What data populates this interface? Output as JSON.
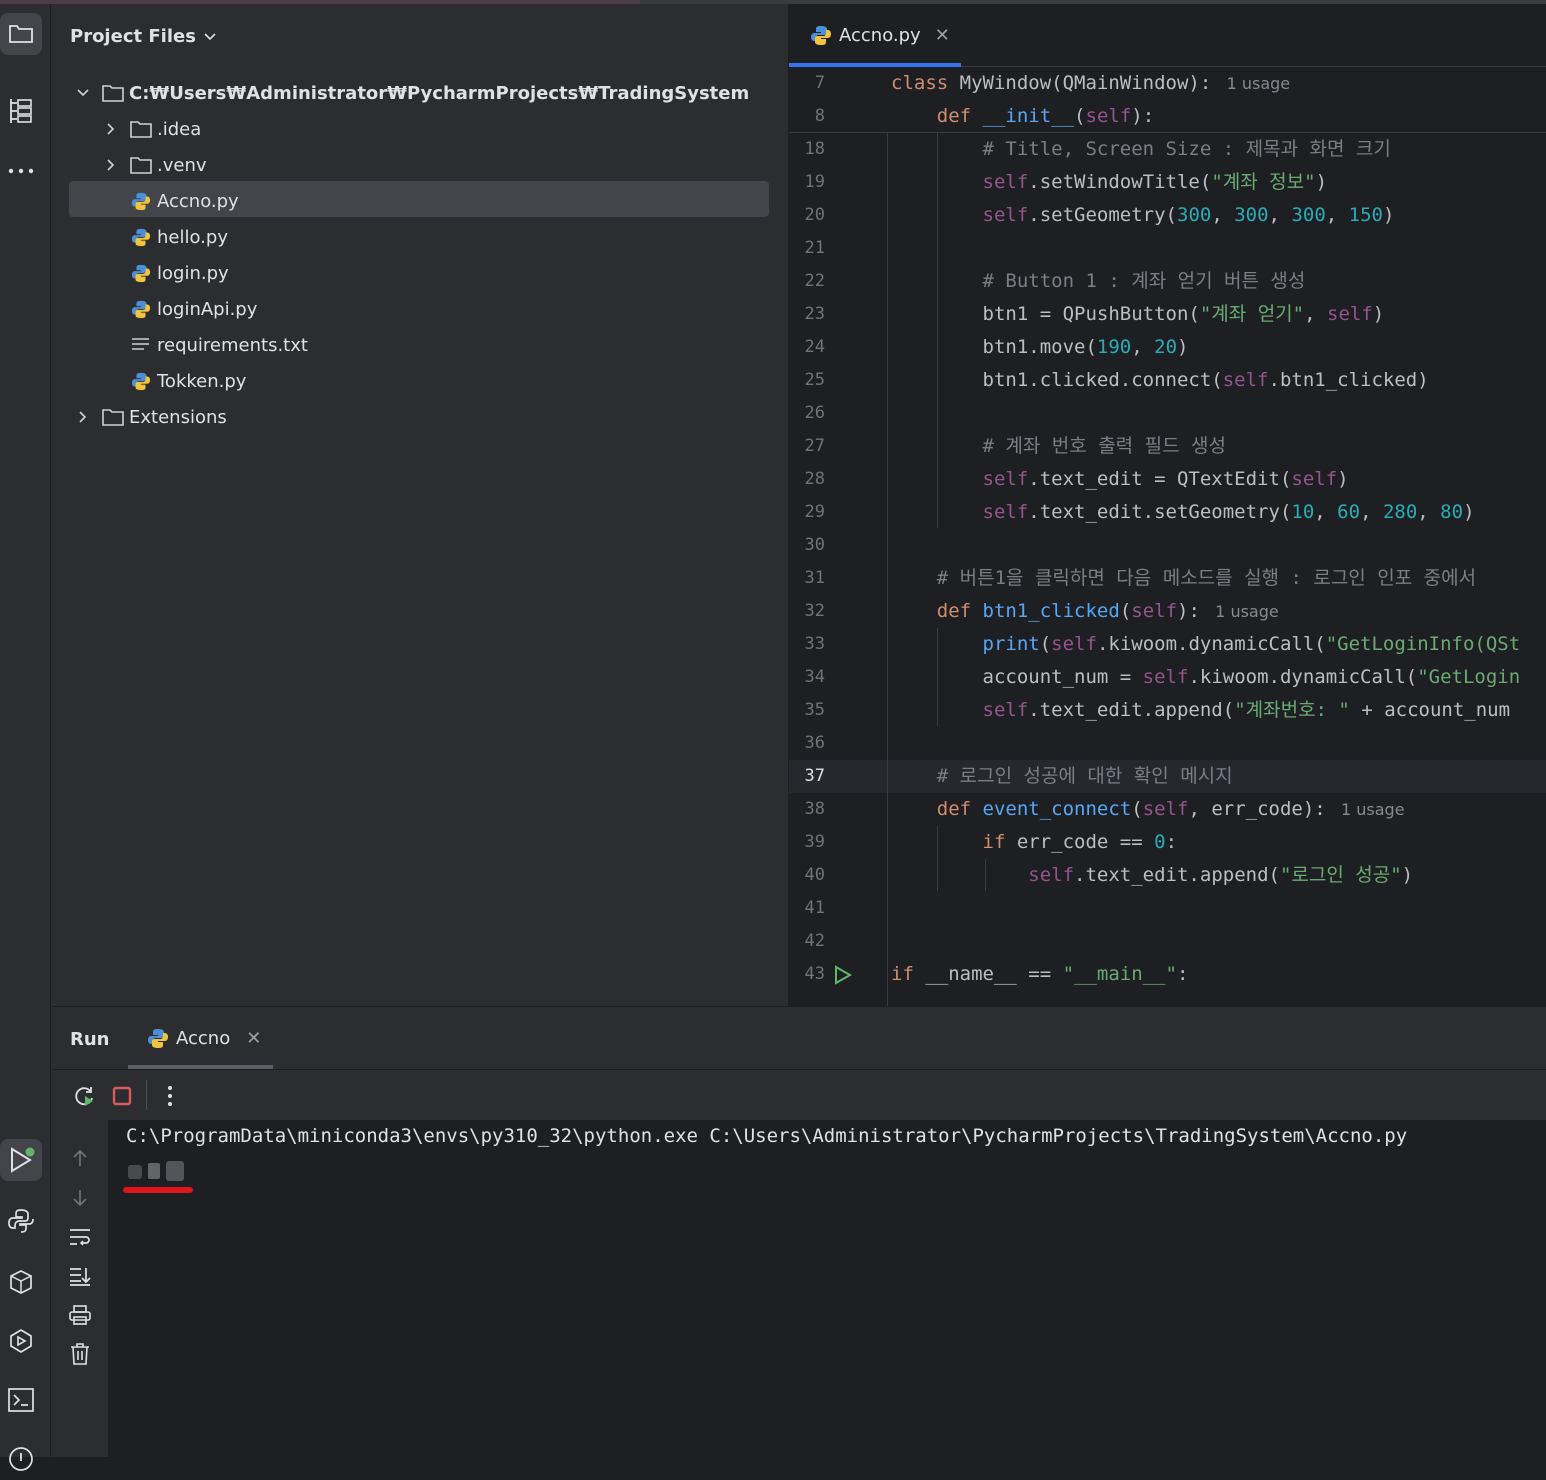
{
  "project": {
    "header": "Project Files",
    "root": "C:₩Users₩Administrator₩PycharmProjects₩TradingSystem",
    "items": [
      {
        "label": ".idea"
      },
      {
        "label": ".venv"
      },
      {
        "label": "Accno.py"
      },
      {
        "label": "hello.py"
      },
      {
        "label": "login.py"
      },
      {
        "label": "loginApi.py"
      },
      {
        "label": "requirements.txt"
      },
      {
        "label": "Tokken.py"
      },
      {
        "label": "Extensions"
      }
    ]
  },
  "editor": {
    "tab": "Accno.py",
    "current_line": "37",
    "usage_hint": "1 usage",
    "lines": [
      {
        "n": "7",
        "parts": [
          [
            "kw",
            "class "
          ],
          [
            "",
            "MyWindow(QMainWindow):"
          ]
        ],
        "hint": "1 usage"
      },
      {
        "n": "8",
        "parts": [
          [
            "",
            "    "
          ],
          [
            "kw",
            "def "
          ],
          [
            "fn",
            "__init__"
          ],
          [
            "",
            "("
          ],
          [
            "self",
            "self"
          ],
          [
            "",
            "):"
          ]
        ]
      },
      {
        "n": "18",
        "parts": [
          [
            "cmt",
            "        # Title, Screen Size : 제목과 화면 크기"
          ]
        ]
      },
      {
        "n": "19",
        "parts": [
          [
            "",
            "        "
          ],
          [
            "self",
            "self"
          ],
          [
            "",
            ".setWindowTitle("
          ],
          [
            "str",
            "\"계좌 정보\""
          ],
          [
            "",
            ")"
          ]
        ]
      },
      {
        "n": "20",
        "parts": [
          [
            "",
            "        "
          ],
          [
            "self",
            "self"
          ],
          [
            "",
            ".setGeometry("
          ],
          [
            "num",
            "300"
          ],
          [
            "",
            ", "
          ],
          [
            "num",
            "300"
          ],
          [
            "",
            ", "
          ],
          [
            "num",
            "300"
          ],
          [
            "",
            ", "
          ],
          [
            "num",
            "150"
          ],
          [
            "",
            ")"
          ]
        ]
      },
      {
        "n": "21",
        "parts": []
      },
      {
        "n": "22",
        "parts": [
          [
            "cmt",
            "        # Button 1 : 계좌 얻기 버튼 생성"
          ]
        ]
      },
      {
        "n": "23",
        "parts": [
          [
            "",
            "        btn1 = QPushButton("
          ],
          [
            "str",
            "\"계좌 얻기\""
          ],
          [
            "",
            ", "
          ],
          [
            "self",
            "self"
          ],
          [
            "",
            ")"
          ]
        ]
      },
      {
        "n": "24",
        "parts": [
          [
            "",
            "        btn1.move("
          ],
          [
            "num",
            "190"
          ],
          [
            "",
            ", "
          ],
          [
            "num",
            "20"
          ],
          [
            "",
            ")"
          ]
        ]
      },
      {
        "n": "25",
        "parts": [
          [
            "",
            "        btn1.clicked.connect("
          ],
          [
            "self",
            "self"
          ],
          [
            "",
            ".btn1_clicked)"
          ]
        ]
      },
      {
        "n": "26",
        "parts": []
      },
      {
        "n": "27",
        "parts": [
          [
            "cmt",
            "        # 계좌 번호 출력 필드 생성"
          ]
        ]
      },
      {
        "n": "28",
        "parts": [
          [
            "",
            "        "
          ],
          [
            "self",
            "self"
          ],
          [
            "",
            ".text_edit = QTextEdit("
          ],
          [
            "self",
            "self"
          ],
          [
            "",
            ")"
          ]
        ]
      },
      {
        "n": "29",
        "parts": [
          [
            "",
            "        "
          ],
          [
            "self",
            "self"
          ],
          [
            "",
            ".text_edit.setGeometry("
          ],
          [
            "num",
            "10"
          ],
          [
            "",
            ", "
          ],
          [
            "num",
            "60"
          ],
          [
            "",
            ", "
          ],
          [
            "num",
            "280"
          ],
          [
            "",
            ", "
          ],
          [
            "num",
            "80"
          ],
          [
            "",
            ")"
          ]
        ]
      },
      {
        "n": "30",
        "parts": []
      },
      {
        "n": "31",
        "parts": [
          [
            "cmt",
            "    # 버튼1을 클릭하면 다음 메소드를 실행 : 로그인 인포 중에서"
          ]
        ]
      },
      {
        "n": "32",
        "parts": [
          [
            "",
            "    "
          ],
          [
            "kw",
            "def "
          ],
          [
            "fn",
            "btn1_clicked"
          ],
          [
            "",
            "("
          ],
          [
            "self",
            "self"
          ],
          [
            "",
            "):"
          ]
        ],
        "hint": "1 usage"
      },
      {
        "n": "33",
        "parts": [
          [
            "",
            "        "
          ],
          [
            "fn",
            "print"
          ],
          [
            "",
            "("
          ],
          [
            "self",
            "self"
          ],
          [
            "",
            ".kiwoom.dynamicCall("
          ],
          [
            "str",
            "\"GetLoginInfo(QSt"
          ]
        ]
      },
      {
        "n": "34",
        "parts": [
          [
            "",
            "        account_num = "
          ],
          [
            "self",
            "self"
          ],
          [
            "",
            ".kiwoom.dynamicCall("
          ],
          [
            "str",
            "\"GetLogin"
          ]
        ]
      },
      {
        "n": "35",
        "parts": [
          [
            "",
            "        "
          ],
          [
            "self",
            "self"
          ],
          [
            "",
            ".text_edit.append("
          ],
          [
            "str",
            "\"계좌번호: \""
          ],
          [
            "",
            " + account_num"
          ]
        ]
      },
      {
        "n": "36",
        "parts": []
      },
      {
        "n": "37",
        "parts": [
          [
            "cmt",
            "    # 로그인 성공에 대한 확인 메시지"
          ]
        ]
      },
      {
        "n": "38",
        "parts": [
          [
            "",
            "    "
          ],
          [
            "kw",
            "def "
          ],
          [
            "fn",
            "event_connect"
          ],
          [
            "",
            "("
          ],
          [
            "self",
            "self"
          ],
          [
            "",
            ", err_code):"
          ]
        ],
        "hint": "1 usage"
      },
      {
        "n": "39",
        "parts": [
          [
            "",
            "        "
          ],
          [
            "kw",
            "if "
          ],
          [
            "",
            "err_code == "
          ],
          [
            "num",
            "0"
          ],
          [
            "",
            ":"
          ]
        ]
      },
      {
        "n": "40",
        "parts": [
          [
            "",
            "            "
          ],
          [
            "self",
            "self"
          ],
          [
            "",
            ".text_edit.append("
          ],
          [
            "str",
            "\"로그인 성공\""
          ],
          [
            "",
            ")"
          ]
        ]
      },
      {
        "n": "41",
        "parts": []
      },
      {
        "n": "42",
        "parts": []
      },
      {
        "n": "43",
        "parts": [
          [
            "kw",
            "if "
          ],
          [
            "",
            "__name__ == "
          ],
          [
            "str",
            "\"__main__\""
          ],
          [
            "",
            ":"
          ]
        ]
      }
    ]
  },
  "run": {
    "title": "Run",
    "tab": "Accno",
    "console_line": "C:\\ProgramData\\miniconda3\\envs\\py310_32\\python.exe C:\\Users\\Administrator\\PycharmProjects\\TradingSystem\\Accno.py"
  },
  "colors": {
    "accent": "#3574f0",
    "keyword": "#cf8e6d",
    "self": "#94558d",
    "function": "#56a8f5",
    "string": "#6aab73",
    "number": "#2aacb8",
    "comment": "#7a7e85",
    "stop": "#db5c5c",
    "run_indicator": "#5fb865",
    "annotation_red": "#e0161a"
  }
}
